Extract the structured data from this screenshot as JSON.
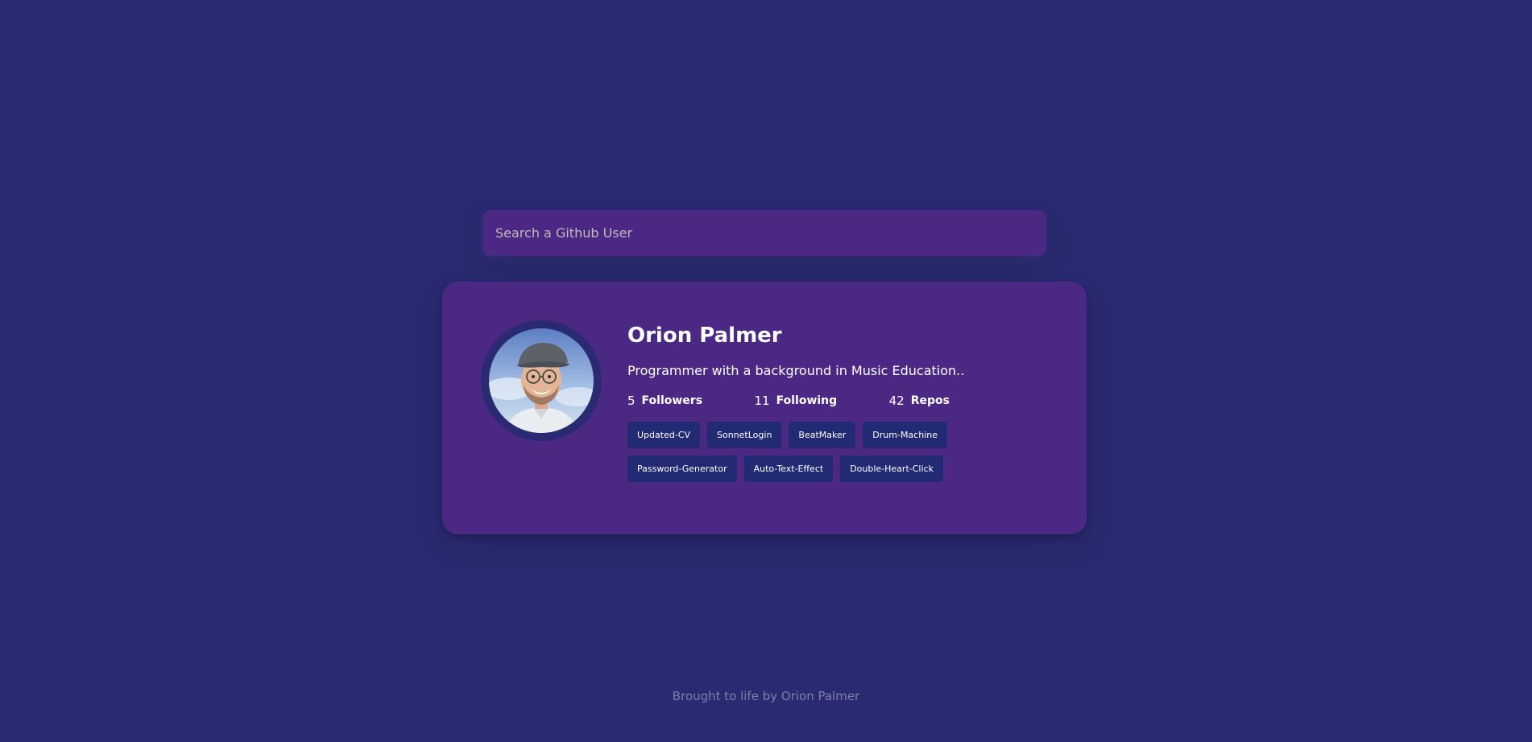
{
  "search": {
    "placeholder": "Search a Github User"
  },
  "profile": {
    "name": "Orion Palmer",
    "bio": "Programmer with a background in Music Education..",
    "stats": {
      "followers_count": "5",
      "followers_label": "Followers",
      "following_count": "11",
      "following_label": "Following",
      "repos_count": "42",
      "repos_label": "Repos"
    },
    "repos": [
      "Updated-CV",
      "SonnetLogin",
      "BeatMaker",
      "Drum-Machine",
      "Password-Generator",
      "Auto-Text-Effect",
      "Double-Heart-Click"
    ]
  },
  "footer": {
    "text": "Brought to life by Orion Palmer"
  },
  "colors": {
    "background": "#2a2a72",
    "card": "#4c2885",
    "repo_chip": "#212a72"
  }
}
